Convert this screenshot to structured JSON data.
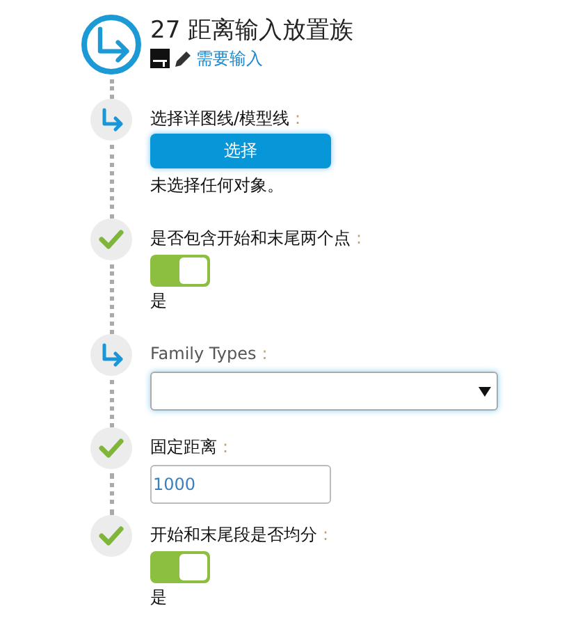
{
  "header": {
    "title": "27 距离输入放置族",
    "status_link": "需要输入"
  },
  "steps": [
    {
      "kind": "select-button",
      "done": false,
      "label": "选择详图线/模型线",
      "colon": ":",
      "button": "选择",
      "note": "未选择任何对象。"
    },
    {
      "kind": "toggle",
      "done": true,
      "label": "是否包含开始和末尾两个点",
      "colon": ":",
      "on": true,
      "value": "是"
    },
    {
      "kind": "dropdown",
      "done": false,
      "label": "Family Types",
      "colon": ":"
    },
    {
      "kind": "number-input",
      "done": true,
      "label": "固定距离",
      "colon": ":",
      "value": "1000"
    },
    {
      "kind": "toggle",
      "done": true,
      "label": "开始和末尾段是否均分",
      "colon": ":",
      "on": true,
      "value": "是"
    }
  ]
}
